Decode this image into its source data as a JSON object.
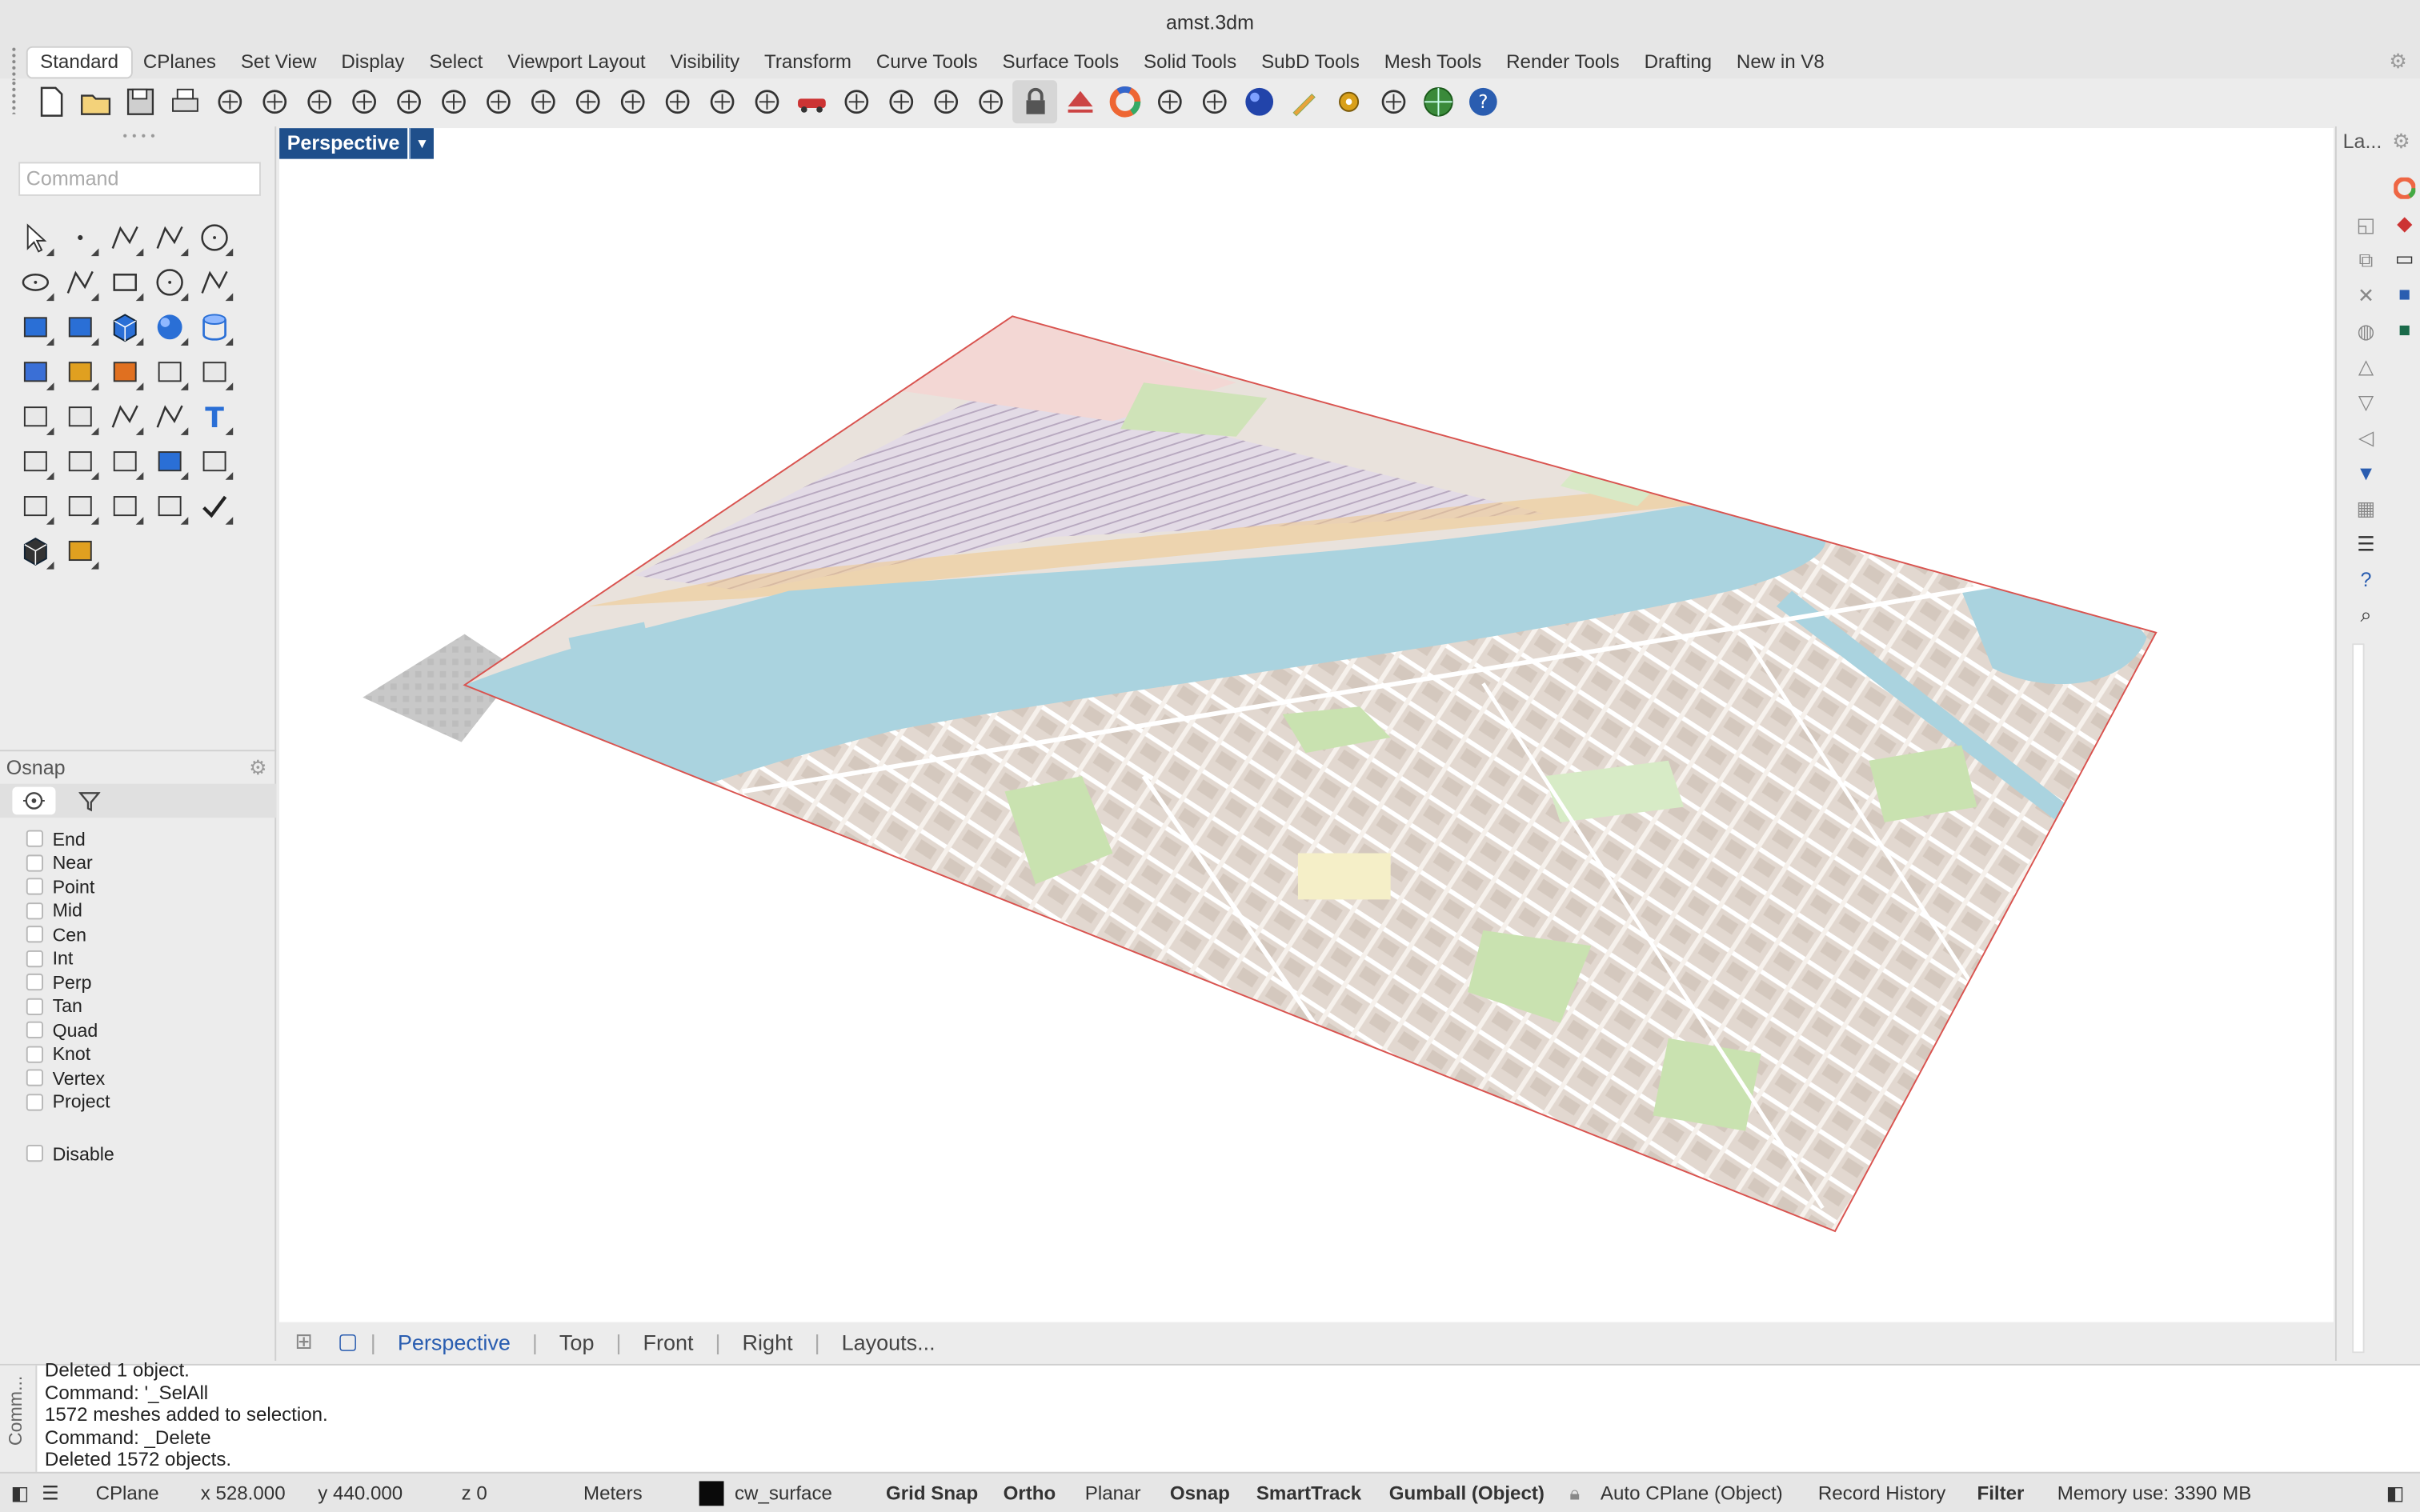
{
  "window": {
    "title": "amst.3dm"
  },
  "tabs": [
    "Standard",
    "CPlanes",
    "Set View",
    "Display",
    "Select",
    "Viewport Layout",
    "Visibility",
    "Transform",
    "Curve Tools",
    "Surface Tools",
    "Solid Tools",
    "SubD Tools",
    "Mesh Tools",
    "Render Tools",
    "Drafting",
    "New in V8"
  ],
  "active_tab": "Standard",
  "toolbar_icons": [
    "new-file",
    "open",
    "save",
    "print",
    "import",
    "cut",
    "copy",
    "paste",
    "undo",
    "pan",
    "rotate-view",
    "zoom",
    "zoom-window",
    "zoom-extents",
    "zoom-selected",
    "rotate",
    "four-viewports",
    "car",
    "grid-plane",
    "cplane-origin",
    "osnap",
    "light",
    "lock",
    "layer",
    "color-wheel",
    "wireframe-sphere",
    "mesh-sphere",
    "render-sphere",
    "pen",
    "gear-settings",
    "curve-tools",
    "globe",
    "help"
  ],
  "command": {
    "placeholder": "Command"
  },
  "left_tools": [
    [
      "select-arrow",
      "point",
      "polyline",
      "curve",
      "circle"
    ],
    [
      "ellipse",
      "arc",
      "rectangle",
      "polygon",
      "fillet"
    ],
    [
      "surface",
      "extrude",
      "box",
      "sphere",
      "cylinder"
    ],
    [
      "mesh",
      "explode",
      "split",
      "trim",
      "offset"
    ],
    [
      "boolean",
      "group",
      "join",
      "move-point",
      "text"
    ],
    [
      "scale",
      "array",
      "rotate-tool",
      "bake",
      "distribute"
    ],
    [
      "grid-array",
      "align",
      "paste",
      "vertical-join",
      "check"
    ],
    [
      "cube",
      "sweep"
    ]
  ],
  "osnap": {
    "title": "Osnap",
    "items": [
      "End",
      "Near",
      "Point",
      "Mid",
      "Cen",
      "Int",
      "Perp",
      "Tan",
      "Quad",
      "Knot",
      "Vertex",
      "Project"
    ],
    "disable": "Disable"
  },
  "viewport": {
    "label": "Perspective"
  },
  "view_tabs": [
    "Perspective",
    "Top",
    "Front",
    "Right",
    "Layouts..."
  ],
  "active_view": "Perspective",
  "right_panel": {
    "label": "La..."
  },
  "history": {
    "side_label": "Comm...",
    "lines": [
      "Deleted 1 object.",
      "Command: '_SelAll",
      "1572 meshes added to selection.",
      "Command: _Delete",
      "Deleted 1572 objects."
    ]
  },
  "status": {
    "cplane": "CPlane",
    "x": "x 528.000",
    "y": "y 440.000",
    "z": "z 0",
    "units": "Meters",
    "layer": "cw_surface",
    "grid_snap": "Grid Snap",
    "ortho": "Ortho",
    "planar": "Planar",
    "osnap": "Osnap",
    "smarttrack": "SmartTrack",
    "gumball": "Gumball (Object)",
    "auto_cplane": "Auto CPlane (Object)",
    "record_history": "Record History",
    "filter": "Filter",
    "memory": "Memory use: 3390 MB"
  },
  "colors": {
    "accent": "#1f4f8b",
    "water": "#aad3df",
    "land": "#e7ded6",
    "outline": "#d9534f"
  }
}
